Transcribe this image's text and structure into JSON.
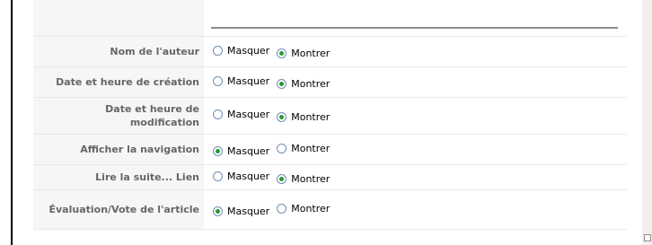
{
  "params": [
    {
      "label": "Nom de l'auteur",
      "options": [
        "Masquer",
        "Montrer"
      ],
      "selected": "Montrer"
    },
    {
      "label": "Date et heure de création",
      "options": [
        "Masquer",
        "Montrer"
      ],
      "selected": "Montrer"
    },
    {
      "label": "Date et heure de modification",
      "options": [
        "Masquer",
        "Montrer"
      ],
      "selected": "Montrer"
    },
    {
      "label": "Afficher la navigation",
      "options": [
        "Masquer",
        "Montrer"
      ],
      "selected": "Masquer"
    },
    {
      "label": "Lire la suite... Lien",
      "options": [
        "Masquer",
        "Montrer"
      ],
      "selected": "Montrer"
    },
    {
      "label": "Évaluation/Vote de l'article",
      "options": [
        "Masquer",
        "Montrer"
      ],
      "selected": "Masquer"
    }
  ],
  "colors": {
    "label_text": "#666666",
    "label_bg": "#f6f6f6",
    "radio_dot": "#1e9e2c",
    "radio_border": "#6f8fb4"
  }
}
